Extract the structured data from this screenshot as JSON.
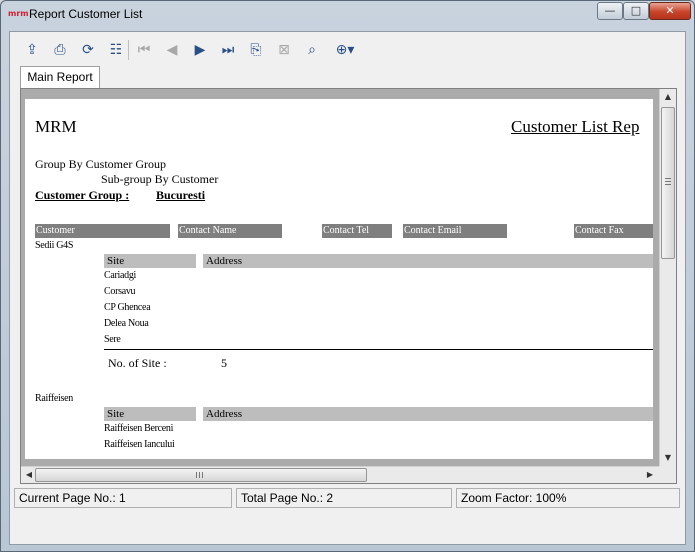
{
  "window": {
    "title": "Report Customer List",
    "app_icon_text": "mrm",
    "minimize_glyph": "—",
    "maximize_glyph": "□",
    "close_glyph": "✕"
  },
  "toolbar": {
    "icons": [
      {
        "name": "export-icon",
        "glyph": "⇪",
        "enabled": true
      },
      {
        "name": "print-icon",
        "glyph": "⎙",
        "enabled": true
      },
      {
        "name": "refresh-icon",
        "glyph": "⟳",
        "enabled": true
      },
      {
        "name": "group-tree-icon",
        "glyph": "☷",
        "enabled": true
      },
      {
        "name": "first-page-icon",
        "glyph": "⏮",
        "enabled": false
      },
      {
        "name": "previous-page-icon",
        "glyph": "◀",
        "enabled": false
      },
      {
        "name": "next-page-icon",
        "glyph": "▶",
        "enabled": true
      },
      {
        "name": "last-page-icon",
        "glyph": "⏭",
        "enabled": true
      },
      {
        "name": "go-to-page-icon",
        "glyph": "⎘",
        "enabled": true
      },
      {
        "name": "stop-icon",
        "glyph": "⊠",
        "enabled": false
      },
      {
        "name": "search-text-icon",
        "glyph": "⌕",
        "enabled": true
      },
      {
        "name": "zoom-icon",
        "glyph": "⊕▾",
        "enabled": true
      }
    ]
  },
  "tabs": {
    "main_report": "Main Report"
  },
  "report": {
    "company": "MRM",
    "title": "Customer List Rep",
    "group_by": "Group By Customer Group",
    "subgroup_by": "Sub-group By Customer",
    "customer_group_label": "Customer Group :",
    "customer_group_value": "Bucuresti",
    "columns": {
      "customer": "Customer",
      "contact_name": "Contact Name",
      "contact_tel": "Contact Tel",
      "contact_email": "Contact Email",
      "contact_fax": "Contact Fax"
    },
    "site_header": "Site",
    "address_header": "Address",
    "customers": [
      {
        "name": "Sedii G4S",
        "sites": [
          "Cariadgi",
          "Corsavu",
          "CP Ghencea",
          "Delea Noua",
          "Sere"
        ],
        "site_count_label": "No. of Site :",
        "site_count": "5"
      },
      {
        "name": "Raiffeisen",
        "sites": [
          "Raiffeisen Berceni",
          "Raiffeisen Iancului"
        ]
      }
    ]
  },
  "statusbar": {
    "current_page": "Current Page No.: 1",
    "total_page": "Total Page No.: 2",
    "zoom": "Zoom Factor: 100%"
  },
  "scrollbars": {
    "up": "▲",
    "down": "▼",
    "left": "◀",
    "right": "▶"
  }
}
